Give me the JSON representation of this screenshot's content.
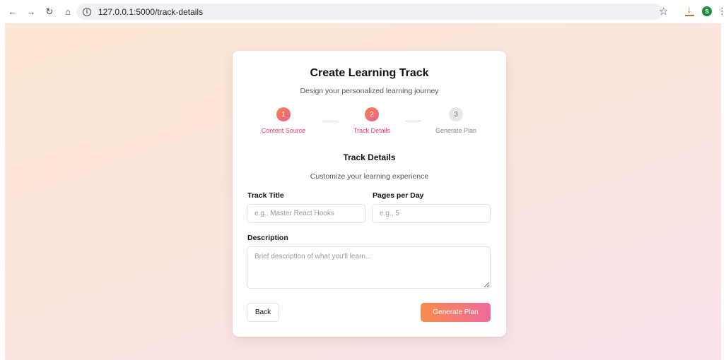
{
  "browser": {
    "url": "127.0.0.1:5000/track-details",
    "profile_initial": "S",
    "icons": [
      "back-arrow-icon",
      "forward-arrow-icon",
      "reload-icon",
      "home-icon",
      "site-info-icon",
      "bookmark-star-icon",
      "download-icon",
      "menu-kebab-icon"
    ]
  },
  "card": {
    "title": "Create Learning Track",
    "subtitle": "Design your personalized learning journey"
  },
  "stepper": {
    "steps": [
      {
        "number": "1",
        "label": "Content Source",
        "state": "active"
      },
      {
        "number": "2",
        "label": "Track Details",
        "state": "active"
      },
      {
        "number": "3",
        "label": "Generate Plan",
        "state": "pending"
      }
    ]
  },
  "section": {
    "title": "Track Details",
    "subtitle": "Customize your learning experience"
  },
  "form": {
    "track_title_label": "Track Title",
    "track_title_placeholder": "e.g., Master React Hooks",
    "track_title_value": "",
    "pages_label": "Pages per Day",
    "pages_placeholder": "e.g., 5",
    "pages_value": "",
    "description_label": "Description",
    "description_placeholder": "Brief description of what you'll learn...",
    "description_value": ""
  },
  "actions": {
    "back_label": "Back",
    "generate_label": "Generate Plan"
  },
  "colors": {
    "accent_start": "#f98b4c",
    "accent_end": "#f06a9b",
    "active_step_text": "#e8397a"
  }
}
